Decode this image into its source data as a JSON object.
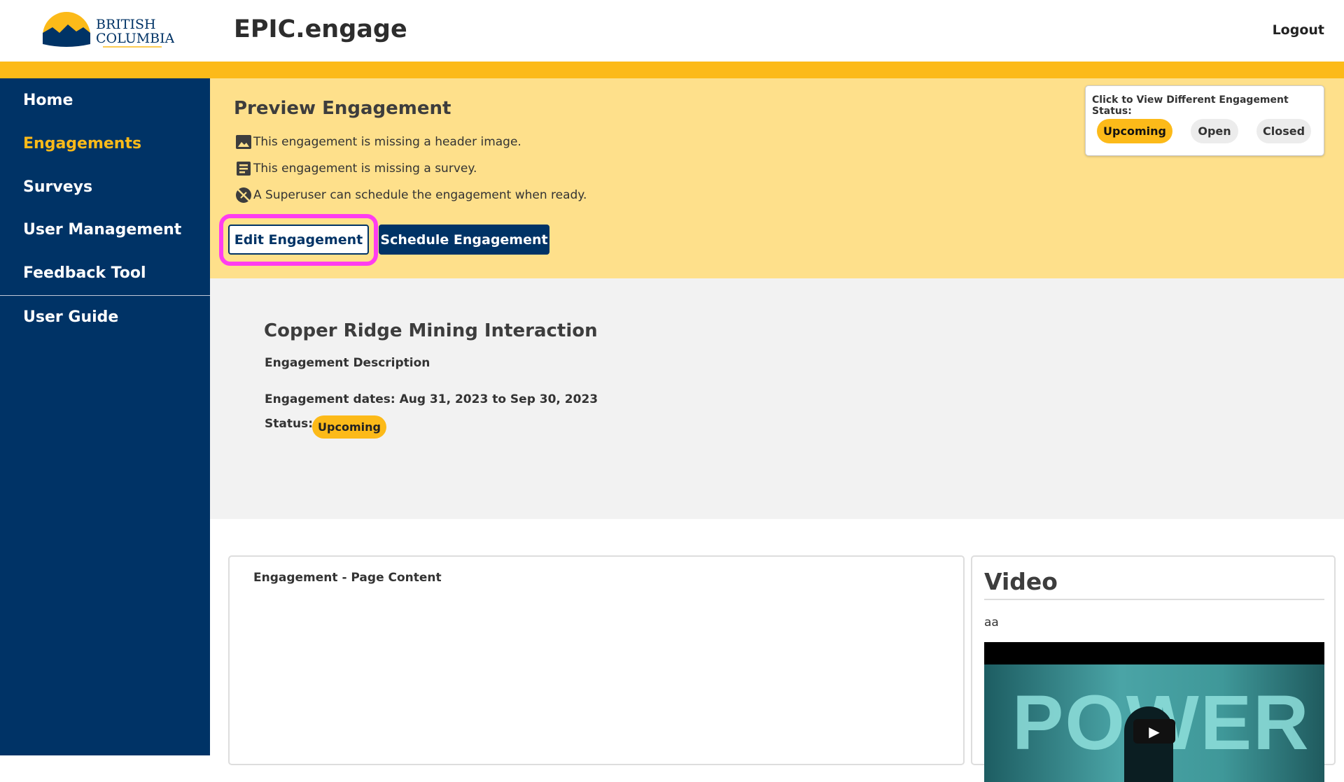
{
  "header": {
    "logo_text": "British Columbia",
    "app_title": "EPIC.engage",
    "logout": "Logout"
  },
  "sidebar": {
    "items": [
      {
        "label": "Home"
      },
      {
        "label": "Engagements",
        "active": true
      },
      {
        "label": "Surveys"
      },
      {
        "label": "User Management"
      },
      {
        "label": "Feedback Tool"
      },
      {
        "label": "User Guide"
      }
    ]
  },
  "preview": {
    "title": "Preview Engagement",
    "warnings": [
      {
        "icon": "image-icon",
        "text": "This engagement is missing a header image."
      },
      {
        "icon": "survey-icon",
        "text": "This engagement is missing a survey."
      },
      {
        "icon": "schedule-off-icon",
        "text": "A Superuser can schedule the engagement when ready."
      }
    ],
    "edit_label": "Edit Engagement",
    "schedule_label": "Schedule Engagement"
  },
  "status_switcher": {
    "label": "Click to View Different Engagement Status:",
    "options": [
      "Upcoming",
      "Open",
      "Closed"
    ],
    "selected": "Upcoming"
  },
  "engagement": {
    "name": "Copper Ridge Mining Interaction",
    "description": "Engagement Description",
    "dates": "Engagement dates: Aug 31, 2023 to Sep 30, 2023",
    "status_label": "Status:",
    "status": "Upcoming"
  },
  "content": {
    "title": "Engagement - Page Content"
  },
  "video": {
    "title": "Video",
    "text": "aa",
    "thumbnail_word": "POWER"
  },
  "colors": {
    "navy": "#003366",
    "gold": "#fcba19",
    "banner": "#fee08b",
    "highlight": "#ff3cf0"
  }
}
